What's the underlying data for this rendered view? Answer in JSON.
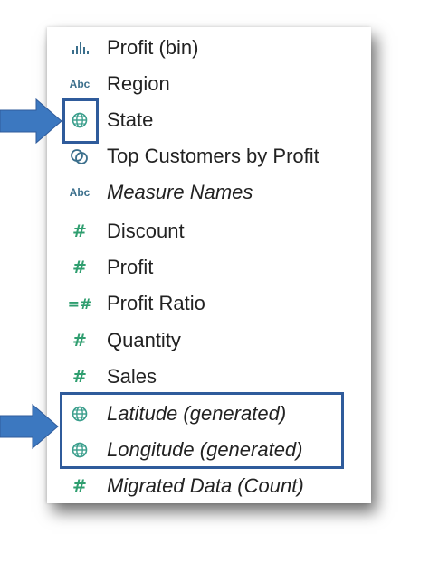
{
  "fields": [
    {
      "icon": "bin-chart-icon",
      "label": "Profit (bin)",
      "italic": false
    },
    {
      "icon": "abc-dimension-icon",
      "icon_text": "Abc",
      "label": "Region",
      "italic": false
    },
    {
      "icon": "globe-icon",
      "label": "State",
      "italic": false
    },
    {
      "icon": "set-icon",
      "label": "Top Customers by Profit",
      "italic": false
    },
    {
      "icon": "abc-dimension-icon",
      "icon_text": "Abc",
      "label": "Measure Names",
      "italic": true
    },
    {
      "icon": "hash-measure-icon",
      "icon_text": "#",
      "label": "Discount",
      "italic": false
    },
    {
      "icon": "hash-measure-icon",
      "icon_text": "#",
      "label": "Profit",
      "italic": false
    },
    {
      "icon": "calculated-hash-icon",
      "icon_text": "=#",
      "label": "Profit Ratio",
      "italic": false
    },
    {
      "icon": "hash-measure-icon",
      "icon_text": "#",
      "label": "Quantity",
      "italic": false
    },
    {
      "icon": "hash-measure-icon",
      "icon_text": "#",
      "label": "Sales",
      "italic": false
    },
    {
      "icon": "globe-icon",
      "label": "Latitude (generated)",
      "italic": true
    },
    {
      "icon": "globe-icon",
      "label": "Longitude (generated)",
      "italic": true
    },
    {
      "icon": "hash-measure-icon",
      "icon_text": "#",
      "label": "Migrated Data (Count)",
      "italic": true
    }
  ],
  "colors": {
    "highlight": "#2f5b9b",
    "arrow": "#3c78c0",
    "icon_teal": "#3a9e8c",
    "abc_blue": "#3b6f8c"
  }
}
